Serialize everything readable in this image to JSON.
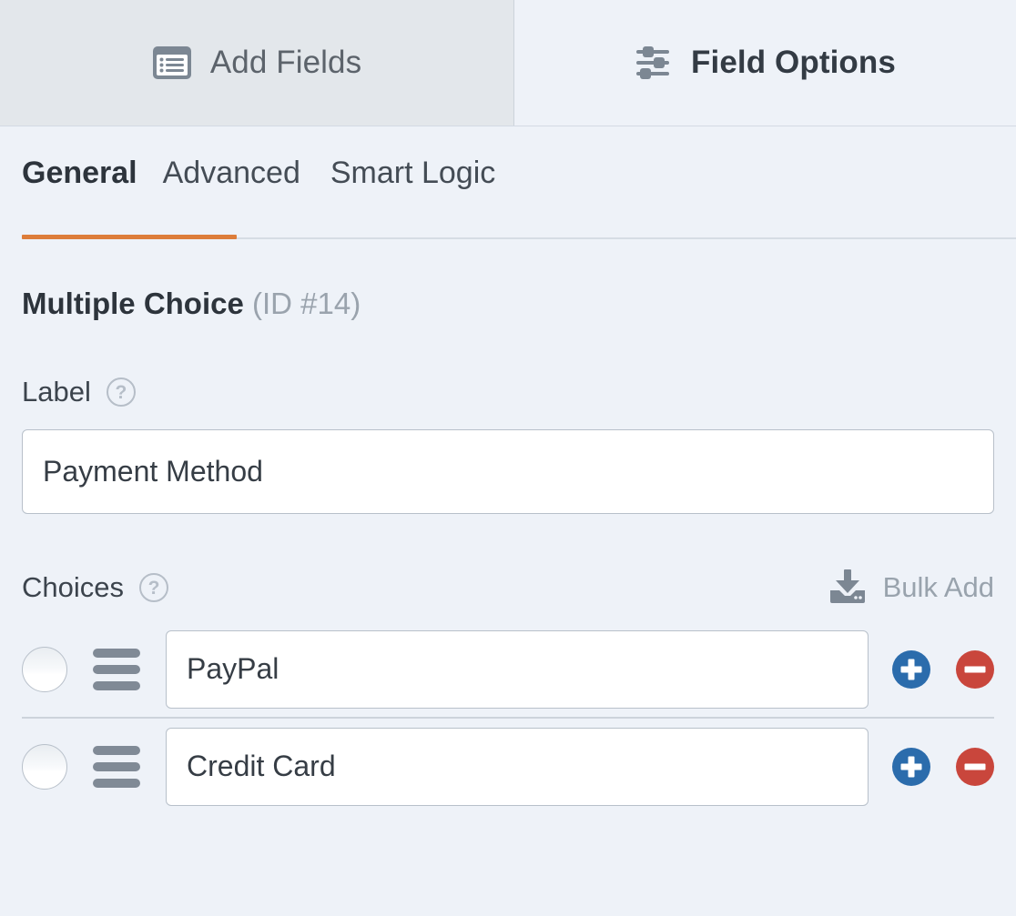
{
  "panel_tabs": [
    {
      "label": "Add Fields",
      "icon": "form-list-icon",
      "active": false
    },
    {
      "label": "Field Options",
      "icon": "sliders-icon",
      "active": true
    }
  ],
  "subtabs": [
    {
      "label": "General",
      "active": true
    },
    {
      "label": "Advanced",
      "active": false
    },
    {
      "label": "Smart Logic",
      "active": false
    }
  ],
  "field": {
    "type_name": "Multiple Choice",
    "id_text": "(ID #14)"
  },
  "label_section": {
    "label": "Label",
    "help_glyph": "?",
    "input_value": "Payment Method",
    "input_placeholder": ""
  },
  "choices_section": {
    "label": "Choices",
    "help_glyph": "?",
    "bulk_add_label": "Bulk Add",
    "bulk_add_icon": "download-import-icon",
    "add_glyph": "+",
    "remove_glyph": "−",
    "items": [
      {
        "value": "PayPal",
        "selected": false
      },
      {
        "value": "Credit Card",
        "selected": false
      }
    ]
  },
  "colors": {
    "accent_orange": "#dd7d3a",
    "add_blue": "#2b6cac",
    "remove_red": "#c9463c",
    "panel_bg": "#eef2f8",
    "inactive_tab_bg": "#e3e7eb"
  }
}
